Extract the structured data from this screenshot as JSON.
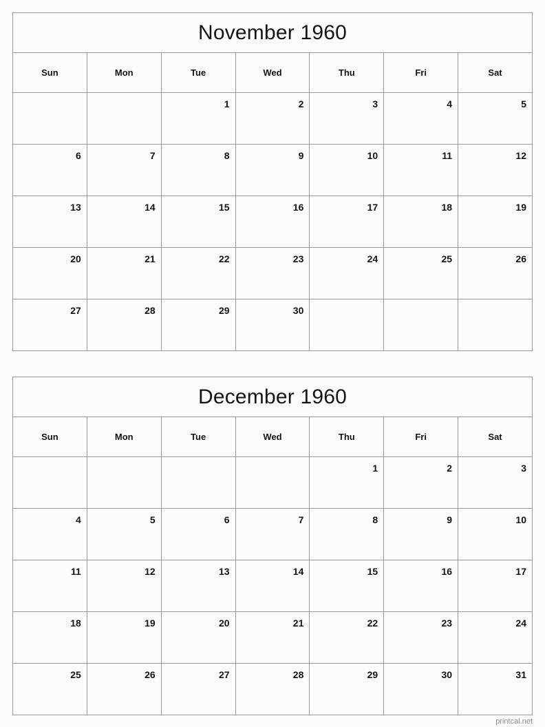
{
  "site": {
    "footer_credit": "printcal.net"
  },
  "calendars": [
    {
      "title": "November 1960",
      "weekdays": [
        "Sun",
        "Mon",
        "Tue",
        "Wed",
        "Thu",
        "Fri",
        "Sat"
      ],
      "weeks": [
        [
          "",
          "",
          "1",
          "2",
          "3",
          "4",
          "5"
        ],
        [
          "6",
          "7",
          "8",
          "9",
          "10",
          "11",
          "12"
        ],
        [
          "13",
          "14",
          "15",
          "16",
          "17",
          "18",
          "19"
        ],
        [
          "20",
          "21",
          "22",
          "23",
          "24",
          "25",
          "26"
        ],
        [
          "27",
          "28",
          "29",
          "30",
          "",
          "",
          ""
        ]
      ]
    },
    {
      "title": "December 1960",
      "weekdays": [
        "Sun",
        "Mon",
        "Tue",
        "Wed",
        "Thu",
        "Fri",
        "Sat"
      ],
      "weeks": [
        [
          "",
          "",
          "",
          "",
          "1",
          "2",
          "3"
        ],
        [
          "4",
          "5",
          "6",
          "7",
          "8",
          "9",
          "10"
        ],
        [
          "11",
          "12",
          "13",
          "14",
          "15",
          "16",
          "17"
        ],
        [
          "18",
          "19",
          "20",
          "21",
          "22",
          "23",
          "24"
        ],
        [
          "25",
          "26",
          "27",
          "28",
          "29",
          "30",
          "31"
        ]
      ]
    }
  ],
  "theme": {
    "page_background": "#fbfdfa",
    "border_color": "#999999",
    "text_color": "#111111",
    "footer_color": "#8c8c8c"
  }
}
